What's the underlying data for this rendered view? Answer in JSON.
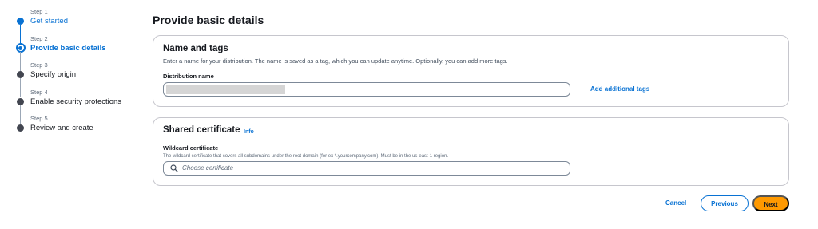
{
  "stepper": {
    "steps": [
      {
        "num": "Step 1",
        "name": "Get started",
        "state": "done"
      },
      {
        "num": "Step 2",
        "name": "Provide basic details",
        "state": "active"
      },
      {
        "num": "Step 3",
        "name": "Specify origin",
        "state": "pending"
      },
      {
        "num": "Step 4",
        "name": "Enable security protections",
        "state": "pending"
      },
      {
        "num": "Step 5",
        "name": "Review and create",
        "state": "pending"
      }
    ]
  },
  "page": {
    "title": "Provide basic details"
  },
  "name_tags": {
    "title": "Name and tags",
    "description": "Enter a name for your distribution. The name is saved as a tag, which you can update anytime. Optionally, you can add more tags.",
    "field_label": "Distribution name",
    "field_value": "",
    "add_tags_label": "Add additional tags"
  },
  "certificate": {
    "title": "Shared certificate",
    "info_label": "Info",
    "field_label": "Wildcard certificate",
    "field_description": "The wildcard certificate that covers all subdomains under the root domain (for ex *.yourcompany.com). Must be in the us-east-1 region.",
    "search_placeholder": "Choose certificate"
  },
  "footer": {
    "cancel_label": "Cancel",
    "previous_label": "Previous",
    "next_label": "Next"
  },
  "colors": {
    "accent": "#0972d3",
    "primary_button": "#ff9900",
    "border": "#c6c6cd"
  },
  "icons": {
    "step_done": "filled-circle-icon",
    "step_active": "ring-circle-icon",
    "step_pending": "filled-circle-icon",
    "search": "search-icon"
  }
}
